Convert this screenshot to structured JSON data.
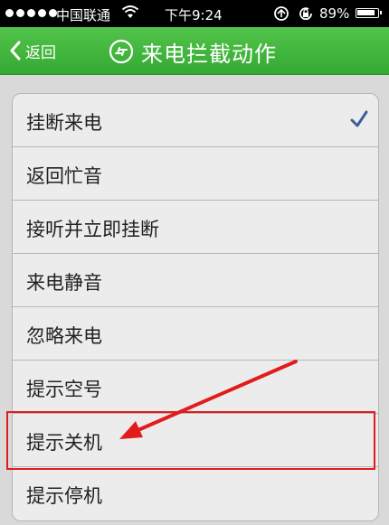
{
  "status_bar": {
    "carrier": "中国联通",
    "time": "下午9:24",
    "battery": "89%"
  },
  "nav": {
    "back_label": "返回",
    "title": "来电拦截动作"
  },
  "options": [
    {
      "label": "挂断来电",
      "selected": true
    },
    {
      "label": "返回忙音",
      "selected": false
    },
    {
      "label": "接听并立即挂断",
      "selected": false
    },
    {
      "label": "来电静音",
      "selected": false
    },
    {
      "label": "忽略来电",
      "selected": false
    },
    {
      "label": "提示空号",
      "selected": false
    },
    {
      "label": "提示关机",
      "selected": false
    },
    {
      "label": "提示停机",
      "selected": false
    }
  ],
  "colors": {
    "nav_green": "#3fb63c",
    "check_blue": "#3d5d9a",
    "annotation_red": "#e21c1c"
  }
}
